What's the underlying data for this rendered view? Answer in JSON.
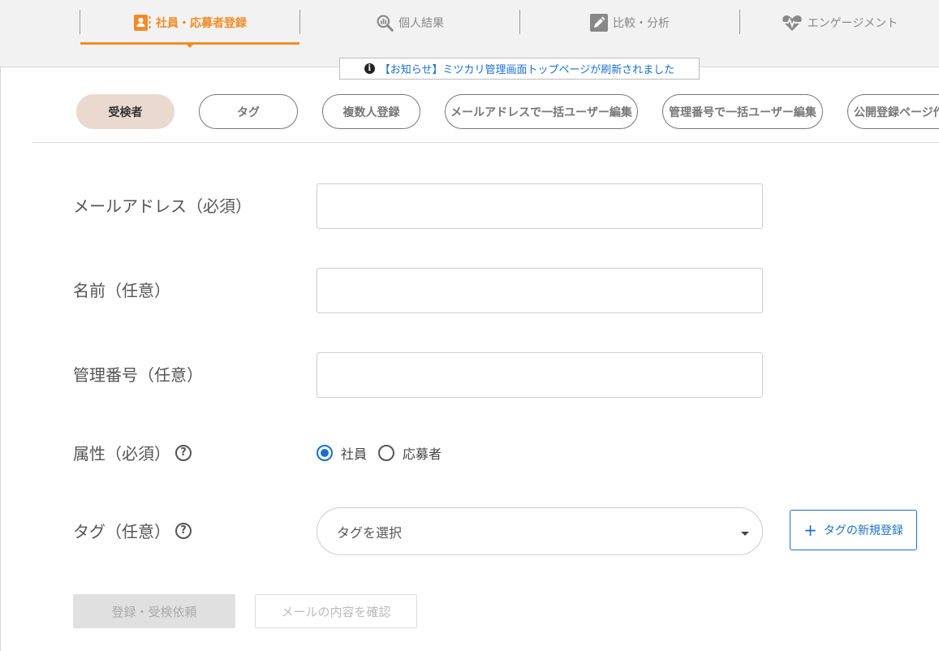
{
  "nav": {
    "tabs": [
      {
        "label": "社員・応募者登録",
        "icon": "user-card-icon"
      },
      {
        "label": "個人結果",
        "icon": "analysis-magnifier-icon"
      },
      {
        "label": "比較・分析",
        "icon": "edit-pencil-icon"
      },
      {
        "label": "エンゲージメント",
        "icon": "heartbeat-icon"
      }
    ],
    "active_color": "#f28c28"
  },
  "notice": {
    "text": "【お知らせ】ミツカリ管理画面トップページが刷新されました",
    "color": "#1a6fd0"
  },
  "subtabs": [
    "受検者",
    "タグ",
    "複数人登録",
    "メールアドレスで一括ユーザー編集",
    "管理番号で一括ユーザー編集",
    "公開登録ページ作成"
  ],
  "form": {
    "email_label": "メールアドレス（必須）",
    "email_value": "",
    "name_label": "名前（任意）",
    "name_value": "",
    "id_label": "管理番号（任意）",
    "id_value": "",
    "attr_label": "属性（必須）",
    "attr_options": [
      "社員",
      "応募者"
    ],
    "attr_selected": "社員",
    "tag_label": "タグ（任意）",
    "tag_placeholder": "タグを選択",
    "new_tag_label": "タグの新規登録",
    "help_glyph": "?"
  },
  "actions": {
    "submit_label": "登録・受検依頼",
    "preview_label": "メールの内容を確認"
  }
}
